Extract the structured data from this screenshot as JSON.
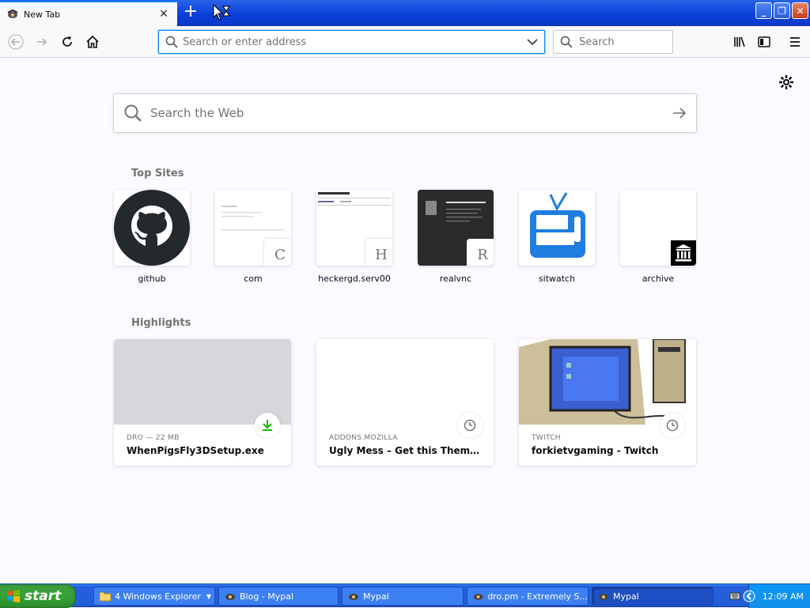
{
  "browser": {
    "tab_title": "New Tab",
    "url_placeholder": "Search or enter address",
    "search_placeholder": "Search"
  },
  "newtab": {
    "search_placeholder": "Search the Web",
    "top_sites_title": "Top Sites",
    "highlights_title": "Highlights",
    "top_sites": [
      {
        "label": "github",
        "badge": ""
      },
      {
        "label": "com",
        "badge": "C"
      },
      {
        "label": "heckergd.serv00",
        "badge": "H"
      },
      {
        "label": "realvnc",
        "badge": "R"
      },
      {
        "label": "sitwatch",
        "badge": ""
      },
      {
        "label": "archive",
        "badge": ""
      }
    ],
    "highlights": [
      {
        "source": "DRO — 22 MB",
        "title": "WhenPigsFly3DSetup.exe",
        "indicator": "download-icon"
      },
      {
        "source": "ADDONS.MOZILLA",
        "title": "Ugly Mess – Get this Theme for …",
        "indicator": "clock-icon"
      },
      {
        "source": "TWITCH",
        "title": "forkietvgaming - Twitch",
        "indicator": "clock-icon"
      }
    ]
  },
  "taskbar": {
    "start_label": "start",
    "buttons": [
      {
        "label": "4 Windows Explorer"
      },
      {
        "label": "Blog - Mypal"
      },
      {
        "label": "Mypal"
      },
      {
        "label": "dro.pm - Extremely S..."
      },
      {
        "label": "Mypal"
      }
    ],
    "clock": "12:09 AM"
  },
  "colors": {
    "accent": "#0a84ff",
    "xp_blue": "#245edb",
    "start_green": "#36a336"
  }
}
